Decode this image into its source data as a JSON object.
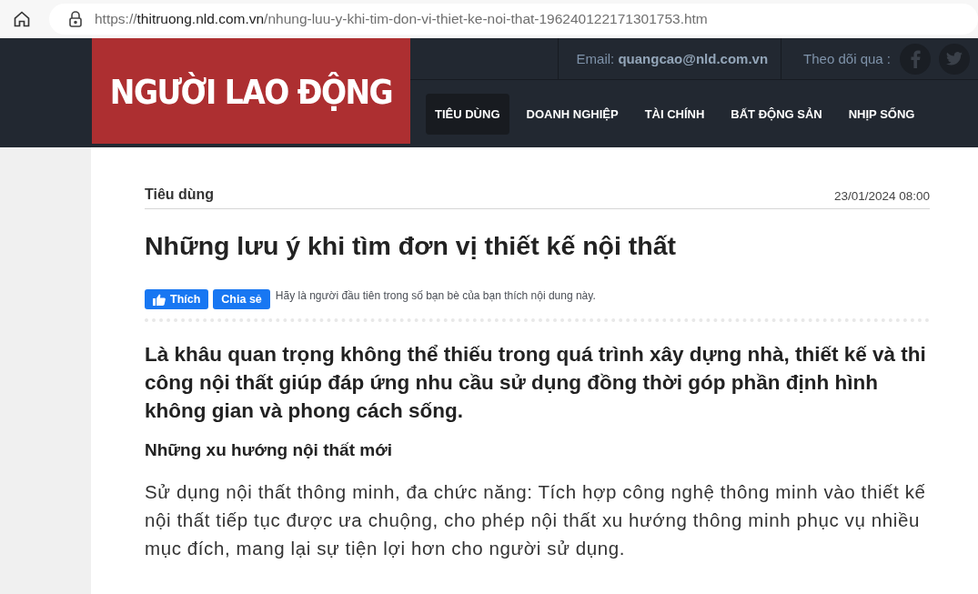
{
  "browser": {
    "url_scheme": "https://",
    "url_host": "thitruong.nld.com.vn",
    "url_path": "/nhung-luu-y-khi-tim-don-vi-thiet-ke-noi-that-196240122171301753.htm"
  },
  "header": {
    "logo": "NGƯỜI LAO ĐỘNG",
    "email": "Email: **quangcao@nld.com.vn**",
    "follow": "Theo dõi qua :",
    "nav": [
      {
        "label": "TIÊU DÙNG",
        "selected": true
      },
      {
        "label": "DOANH NGHIỆP",
        "selected": false
      },
      {
        "label": "TÀI CHÍNH",
        "selected": false
      },
      {
        "label": "BẤT ĐỘNG SẢN",
        "selected": false
      },
      {
        "label": "NHỊP SỐNG",
        "selected": false
      }
    ]
  },
  "article": {
    "category": "Tiêu dùng",
    "date": "23/01/2024 08:00",
    "title": "Những lưu ý khi tìm đơn vị thiết kế nội thất",
    "like_button": "Thích",
    "share_button": "Chia sẻ",
    "social_note": "Hãy là người đầu tiên trong số bạn bè của bạn thích nội dung này.",
    "lead": "Là khâu quan trọng không thể thiếu trong quá trình xây dựng nhà, thiết kế và thi công nội thất giúp đáp ứng nhu cầu sử dụng đồng thời góp phần định hình không gian và phong cách sống.",
    "subheading": "Những xu hướng nội thất mới",
    "paragraph": "Sử dụng nội thất thông minh, đa chức năng: Tích hợp công nghệ thông minh vào thiết kế nội thất tiếp tục được ưa chuộng, cho phép nội thất xu hướng thông minh phục vụ nhiều mục đích, mang lại sự tiện lợi hơn cho người sử dụng."
  }
}
